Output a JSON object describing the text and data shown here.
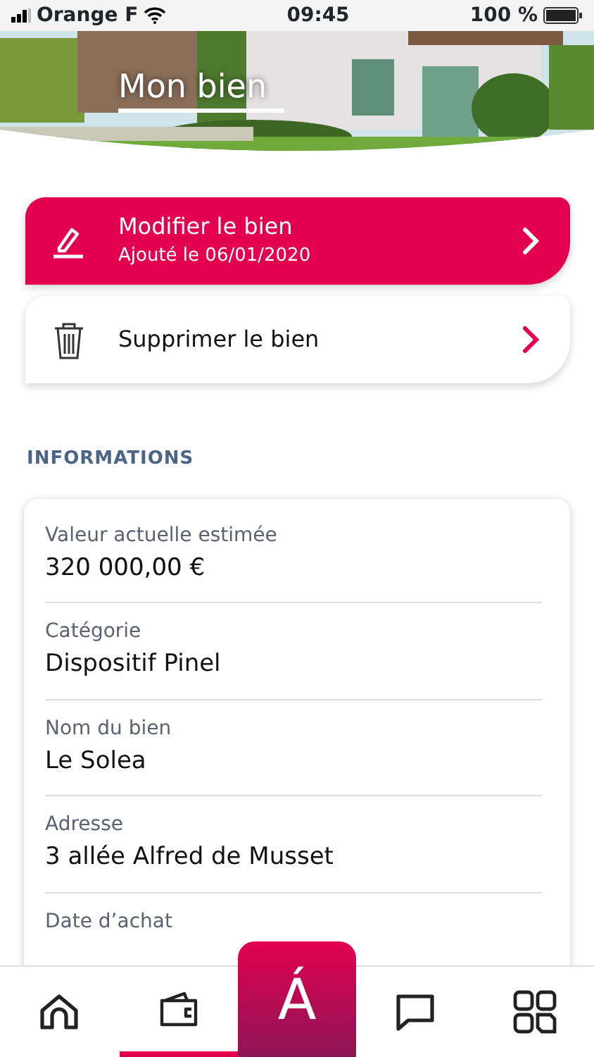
{
  "status_bar": {
    "carrier": "Orange F",
    "time": "09:45",
    "battery": "100 %"
  },
  "header": {
    "title": "Mon bien"
  },
  "actions": [
    {
      "kind": "primary",
      "title": "Modifier le bien",
      "subtitle": "Ajouté le 06/01/2020"
    },
    {
      "kind": "secondary",
      "title": "Supprimer le bien"
    }
  ],
  "section_title": "INFORMATIONS",
  "fields": [
    {
      "label": "Valeur actuelle estimée",
      "value": "320 000,00 €"
    },
    {
      "label": "Catégorie",
      "value": "Dispositif Pinel"
    },
    {
      "label": "Nom du bien",
      "value": "Le Solea"
    },
    {
      "label": "Adresse",
      "value": "3 allée Alfred de Musset"
    },
    {
      "label": "Date d’achat"
    }
  ],
  "tab_bar": [
    {
      "kind": "home",
      "selected": false
    },
    {
      "kind": "wallet",
      "selected": true
    },
    {
      "kind": "logo",
      "text": "Á"
    },
    {
      "kind": "chat",
      "selected": false
    },
    {
      "kind": "grid",
      "selected": false
    }
  ]
}
